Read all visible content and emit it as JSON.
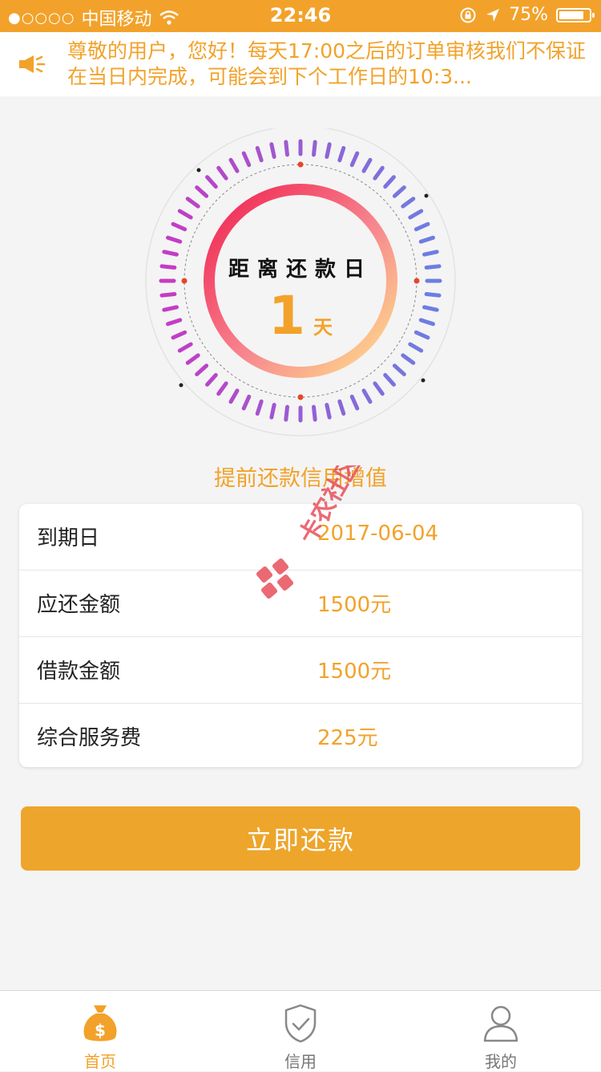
{
  "status_bar": {
    "carrier": "中国移动",
    "time": "22:46",
    "battery": "75%"
  },
  "notice": {
    "text": "尊敬的用户，您好！每天17:00之后的订单审核我们不保证在当日内完成，可能会到下个工作日的10:3..."
  },
  "countdown": {
    "title": "距离还款日",
    "days": "1",
    "unit": "天"
  },
  "tip": "提前还款信用增值",
  "details": [
    {
      "label": "到期日",
      "value": "2017-06-04"
    },
    {
      "label": "应还金额",
      "value": "1500元"
    },
    {
      "label": "借款金额",
      "value": "1500元"
    },
    {
      "label": "综合服务费",
      "value": "225元"
    }
  ],
  "repay_button": "立即还款",
  "watermark": "卡农社区",
  "tabs": [
    {
      "label": "首页",
      "icon": "money-bag-icon",
      "active": true
    },
    {
      "label": "信用",
      "icon": "shield-check-icon",
      "active": false
    },
    {
      "label": "我的",
      "icon": "user-icon",
      "active": false
    }
  ],
  "colors": {
    "accent": "#f2a22a",
    "ring_start": "#f0204f",
    "ring_end": "#ffe28a"
  }
}
